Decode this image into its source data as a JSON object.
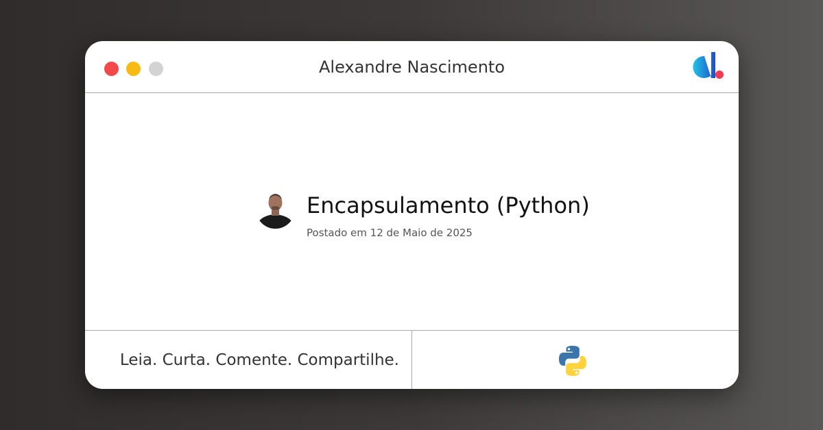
{
  "window": {
    "title": "Alexandre Nascimento",
    "controls": [
      "close",
      "minimize",
      "maximize"
    ],
    "logo_icon": "dev-logo-icon"
  },
  "post": {
    "title": "Encapsulamento (Python)",
    "date": "Postado em 12 de Maio de 2025",
    "avatar": "author-avatar"
  },
  "footer": {
    "tagline": "Leia. Curta. Comente. Compartilhe.",
    "icon": "python-icon"
  },
  "colors": {
    "close": "#f24a4a",
    "minimize": "#f7bb13",
    "maximize": "#d3d3d3",
    "python_blue": "#3a75ac",
    "python_yellow": "#fdd43b",
    "logo_blue": "#1c5fd1",
    "logo_red": "#ef3b53"
  }
}
